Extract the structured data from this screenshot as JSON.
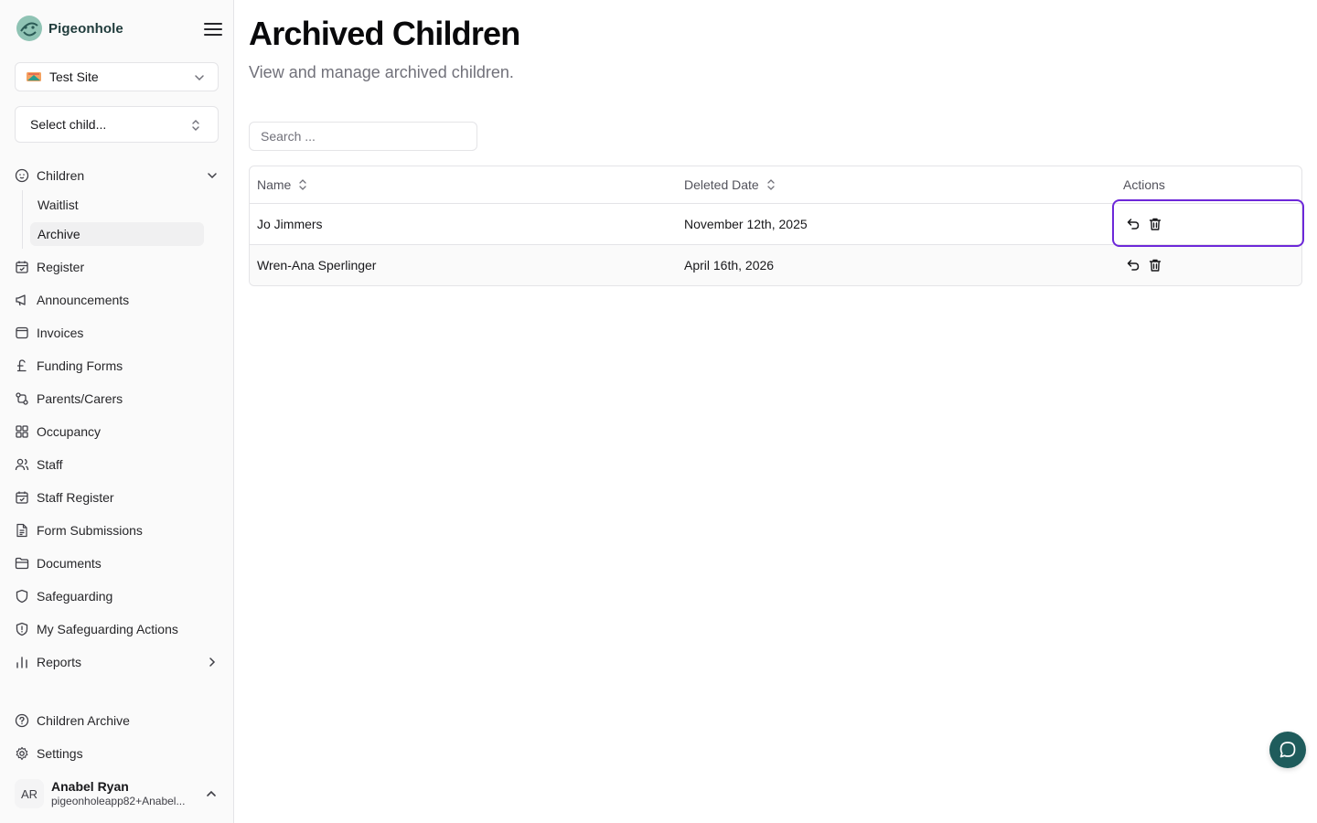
{
  "app": {
    "name": "Pigeonhole"
  },
  "site_selector": {
    "value": "Test Site"
  },
  "child_selector": {
    "placeholder": "Select child..."
  },
  "nav": {
    "children": {
      "label": "Children",
      "sub": [
        {
          "label": "Waitlist"
        },
        {
          "label": "Archive"
        }
      ]
    },
    "items": [
      {
        "label": "Register",
        "icon": "calendar-check-icon"
      },
      {
        "label": "Announcements",
        "icon": "megaphone-icon"
      },
      {
        "label": "Invoices",
        "icon": "invoice-icon"
      },
      {
        "label": "Funding Forms",
        "icon": "pound-icon"
      },
      {
        "label": "Parents/Carers",
        "icon": "git-compare-icon"
      },
      {
        "label": "Occupancy",
        "icon": "grid-icon"
      },
      {
        "label": "Staff",
        "icon": "users-icon"
      },
      {
        "label": "Staff Register",
        "icon": "calendar-check-icon"
      },
      {
        "label": "Form Submissions",
        "icon": "file-text-icon"
      },
      {
        "label": "Documents",
        "icon": "folder-icon"
      },
      {
        "label": "Safeguarding",
        "icon": "shield-icon"
      },
      {
        "label": "My Safeguarding Actions",
        "icon": "shield-alert-icon"
      },
      {
        "label": "Reports",
        "icon": "bar-chart-icon"
      }
    ],
    "footer": [
      {
        "label": "Children Archive",
        "icon": "help-circle-icon"
      },
      {
        "label": "Settings",
        "icon": "gear-icon"
      }
    ]
  },
  "user": {
    "initials": "AR",
    "name": "Anabel Ryan",
    "email": "pigeonholeapp82+Anabel..."
  },
  "page": {
    "title": "Archived Children",
    "subtitle": "View and manage archived children."
  },
  "search": {
    "placeholder": "Search ..."
  },
  "table": {
    "columns": [
      {
        "label": "Name"
      },
      {
        "label": "Deleted Date"
      },
      {
        "label": "Actions"
      }
    ],
    "rows": [
      {
        "name": "Jo Jimmers",
        "deleted_date": "November 12th, 2025"
      },
      {
        "name": "Wren-Ana Sperlinger",
        "deleted_date": "April 16th, 2026"
      }
    ]
  },
  "colors": {
    "brand": "#1f5c5c",
    "focus": "#6d28d9",
    "border": "#e4e4e7",
    "muted": "#71717a"
  }
}
